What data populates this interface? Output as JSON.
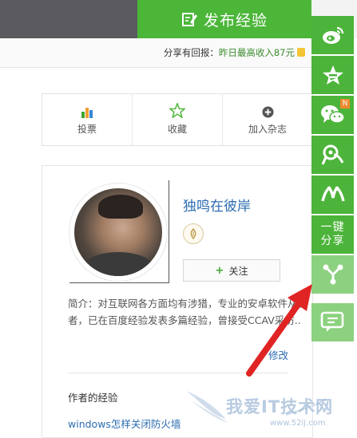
{
  "header": {
    "publish_label": "发布经验",
    "reward_prefix": "分享有回报：",
    "reward_text": "昨日最高收入87元"
  },
  "actions": [
    {
      "label": "投票",
      "icon": "bar-chart-icon"
    },
    {
      "label": "收藏",
      "icon": "star-outline-icon"
    },
    {
      "label": "加入杂志",
      "icon": "plus-circle-icon"
    }
  ],
  "profile": {
    "username": "独鸣在彼岸",
    "follow_label": "关注",
    "bio": "简介：对互联网各方面均有涉猎，专业的安卓软件从业者，已在百度经验发表多篇经验，曾接受CCAV采访..",
    "edit_label": "修改",
    "experience_title": "作者的经验",
    "experience_link": "windows怎样关闭防火墙"
  },
  "sidebar": {
    "share_label_1": "一键",
    "share_label_2": "分享",
    "wechat_badge": "N",
    "icons": [
      "weibo-icon",
      "qzone-star-icon",
      "wechat-icon",
      "tieba-icon",
      "renren-icon",
      "share-network-icon",
      "feedback-chat-icon"
    ]
  },
  "watermark": {
    "text": "我爱IT技术网",
    "url": "www.52ij.com"
  },
  "colors": {
    "accent_green": "#4cb639",
    "highlight_green": "#8cd17f",
    "link_blue": "#2b6cb0",
    "arrow_red": "#e02424"
  }
}
